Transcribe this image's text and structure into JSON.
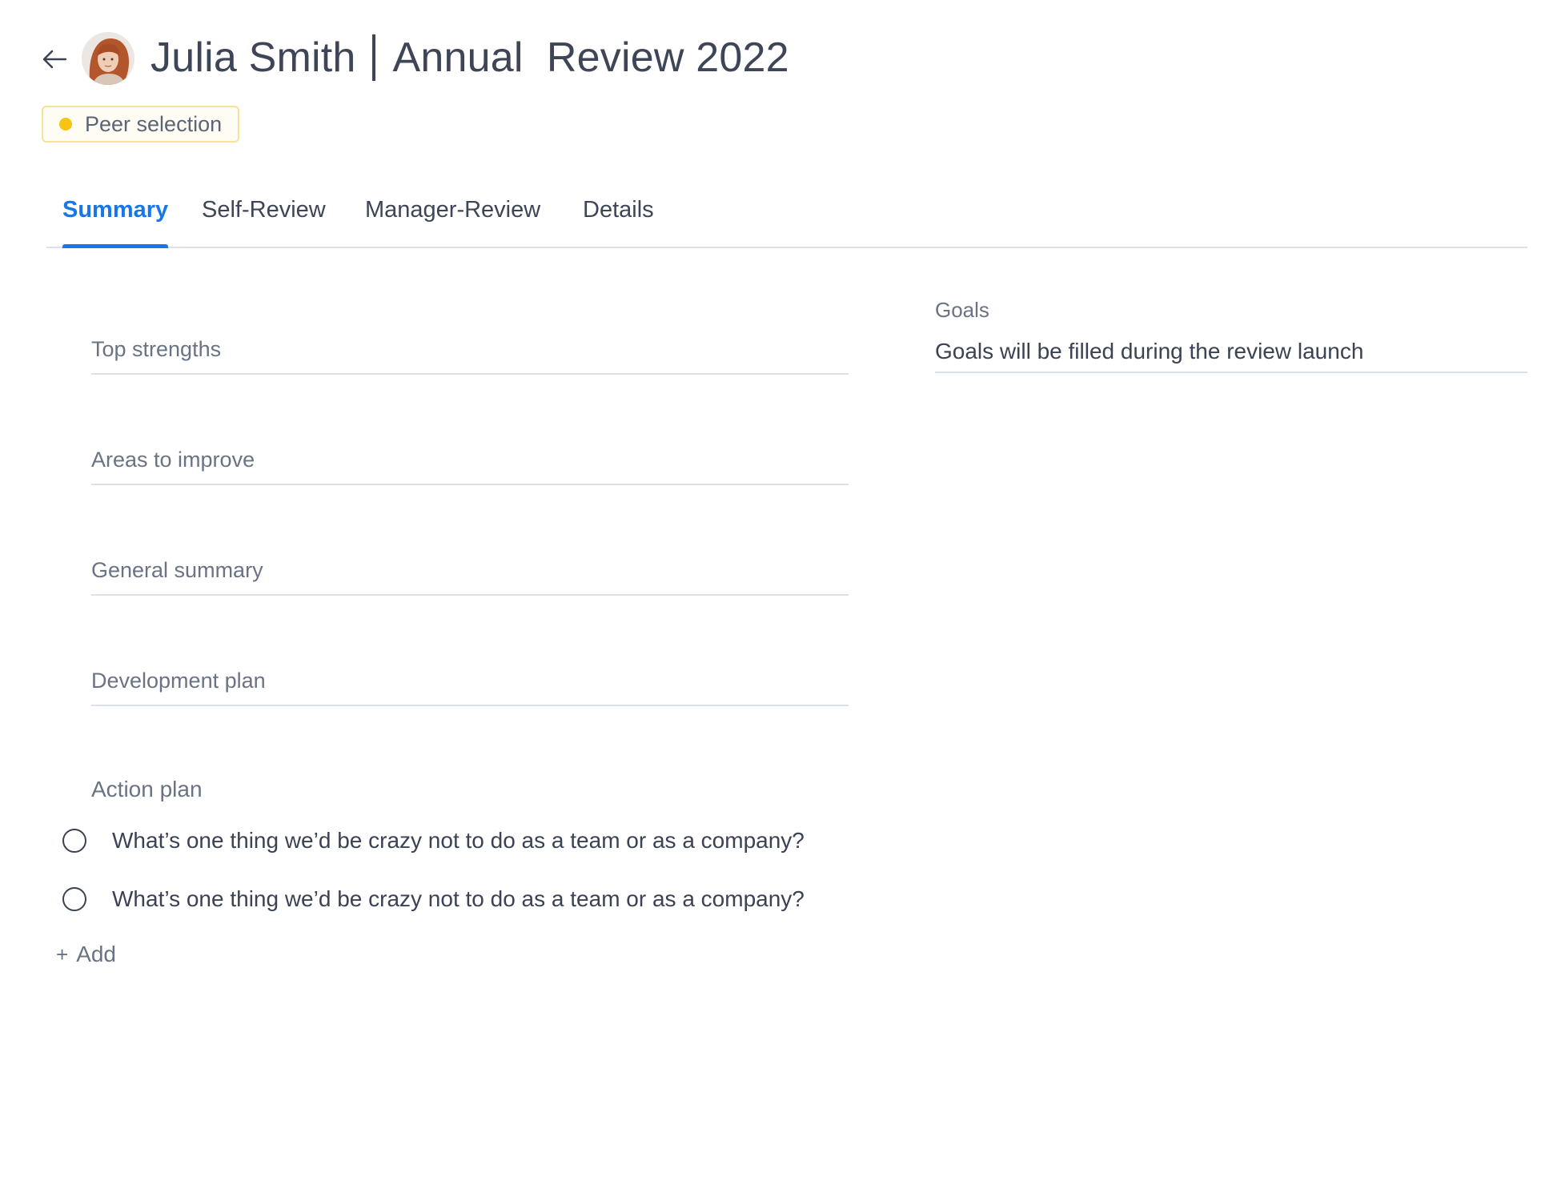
{
  "header": {
    "title_name": "Julia Smith",
    "title_review": "Annual  Review 2022",
    "avatar_icon": "user-avatar-photo",
    "back_icon": "arrow-left-icon"
  },
  "status": {
    "label": "Peer selection",
    "dot_color": "#f5c414"
  },
  "tabs": [
    {
      "label": "Summary",
      "active": true
    },
    {
      "label": "Self-Review",
      "active": false
    },
    {
      "label": "Manager-Review",
      "active": false
    },
    {
      "label": "Details",
      "active": false
    }
  ],
  "fields": {
    "top_strengths": "Top strengths",
    "areas_to_improve": "Areas to improve",
    "general_summary": "General summary",
    "development_plan": "Development plan"
  },
  "goals": {
    "label": "Goals",
    "value": "Goals will be filled during the review launch"
  },
  "action_plan": {
    "label": "Action plan",
    "items": [
      {
        "text": "What’s one thing we’d be crazy not to do as a team or as a company?",
        "checked": false
      },
      {
        "text": "What’s one thing we’d be crazy not to do as a team or as a company?",
        "checked": false
      }
    ],
    "add_label": "Add"
  },
  "colors": {
    "accent": "#1877e8",
    "text": "#3a4253",
    "muted": "#6a7384",
    "divider": "#dcdfe4"
  }
}
